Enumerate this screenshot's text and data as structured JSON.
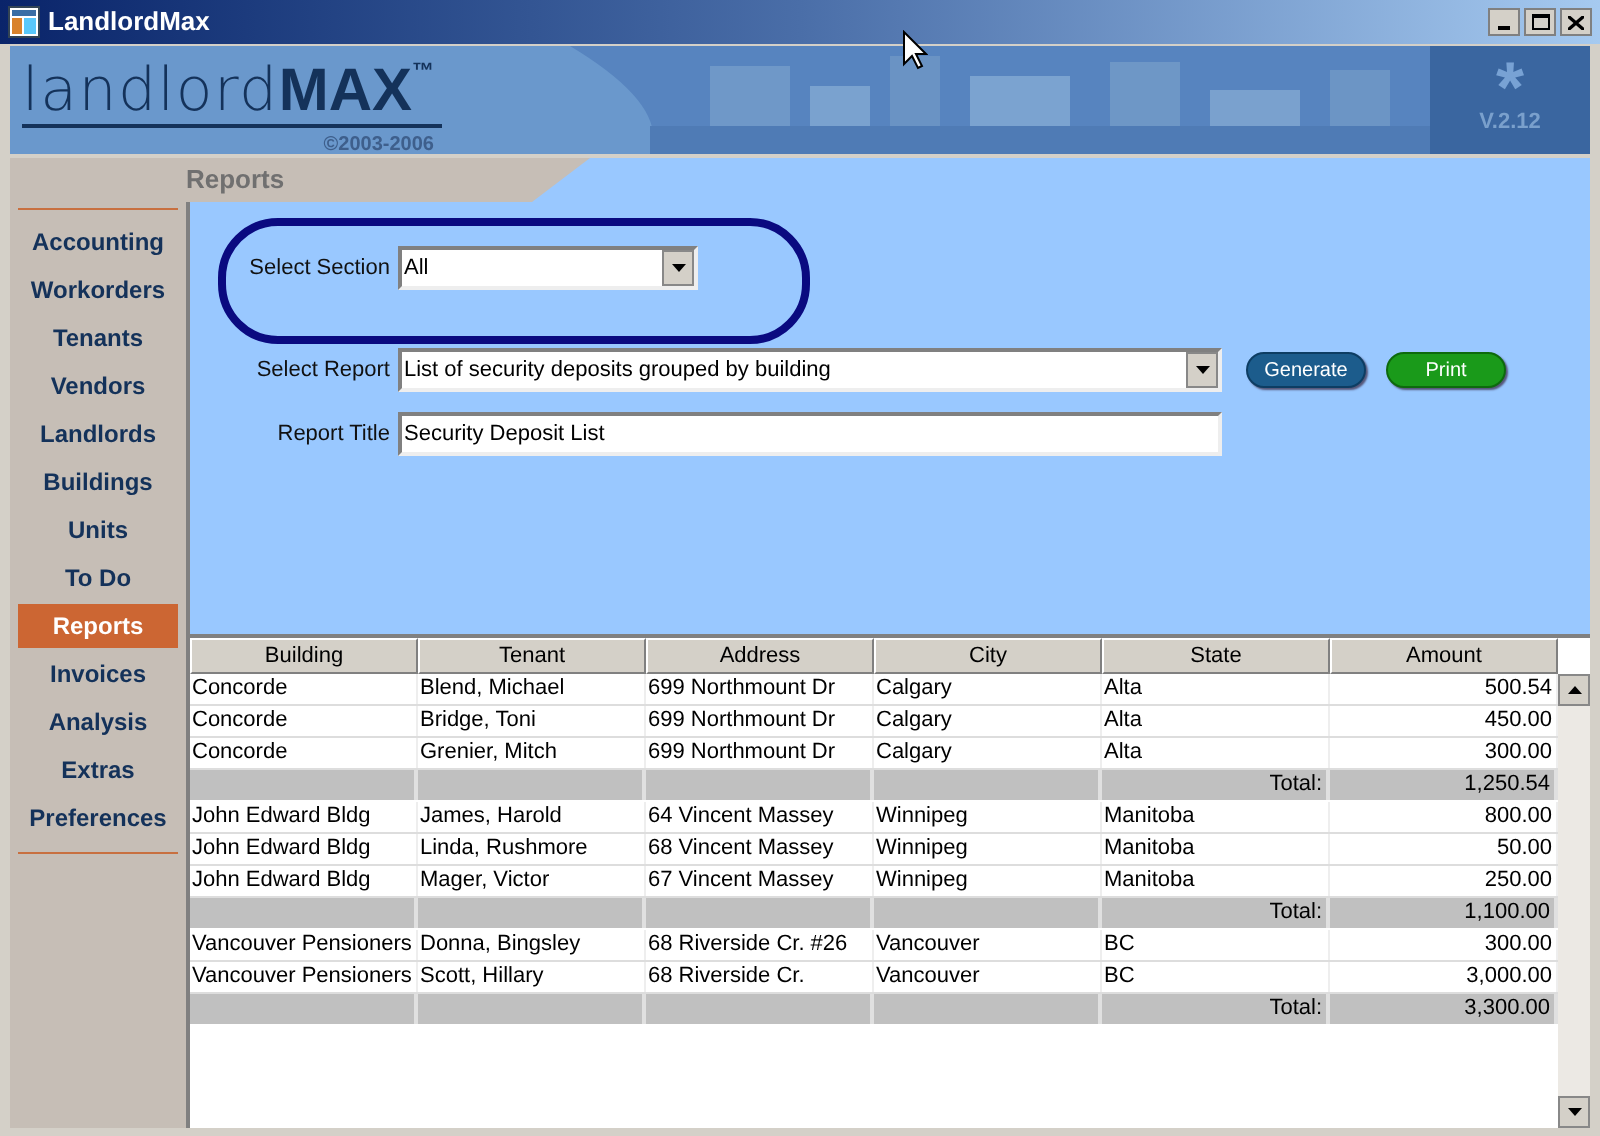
{
  "window": {
    "title": "LandlordMax"
  },
  "banner": {
    "logo_light": "landlord",
    "logo_bold": "MAX",
    "trademark": "™",
    "copyright": "©2003-2006",
    "badge_symbol": "*",
    "version": "V.2.12"
  },
  "section_title": "Reports",
  "sidebar": {
    "items": [
      {
        "label": "Accounting",
        "selected": false
      },
      {
        "label": "Workorders",
        "selected": false
      },
      {
        "label": "Tenants",
        "selected": false
      },
      {
        "label": "Vendors",
        "selected": false
      },
      {
        "label": "Landlords",
        "selected": false
      },
      {
        "label": "Buildings",
        "selected": false
      },
      {
        "label": "Units",
        "selected": false
      },
      {
        "label": "To Do",
        "selected": false
      },
      {
        "label": "Reports",
        "selected": true
      },
      {
        "label": "Invoices",
        "selected": false
      },
      {
        "label": "Analysis",
        "selected": false
      },
      {
        "label": "Extras",
        "selected": false
      },
      {
        "label": "Preferences",
        "selected": false
      }
    ]
  },
  "form": {
    "section": {
      "label": "Select Section",
      "value": "All"
    },
    "report": {
      "label": "Select Report",
      "value": "List of security deposits grouped by building"
    },
    "title": {
      "label": "Report Title",
      "value": "Security Deposit List"
    },
    "buttons": [
      {
        "label": "Generate",
        "kind": "primary"
      },
      {
        "label": "Print",
        "kind": "print"
      }
    ]
  },
  "table": {
    "columns": [
      "Building",
      "Tenant",
      "Address",
      "City",
      "State",
      "Amount"
    ],
    "rows": [
      {
        "kind": "data",
        "cells": [
          "Concorde",
          "Blend, Michael",
          "699 Northmount Dr",
          "Calgary",
          "Alta",
          "500.54"
        ]
      },
      {
        "kind": "data",
        "cells": [
          "Concorde",
          "Bridge, Toni",
          "699 Northmount Dr",
          "Calgary",
          "Alta",
          "450.00"
        ]
      },
      {
        "kind": "data",
        "cells": [
          "Concorde",
          "Grenier, Mitch",
          "699 Northmount Dr",
          "Calgary",
          "Alta",
          "300.00"
        ]
      },
      {
        "kind": "total",
        "label": "Total:",
        "amount": "1,250.54"
      },
      {
        "kind": "data",
        "cells": [
          "John Edward Bldg",
          "James, Harold",
          "64 Vincent Massey",
          "Winnipeg",
          "Manitoba",
          "800.00"
        ]
      },
      {
        "kind": "data",
        "cells": [
          "John Edward Bldg",
          "Linda, Rushmore",
          "68 Vincent Massey",
          "Winnipeg",
          "Manitoba",
          "50.00"
        ]
      },
      {
        "kind": "data",
        "cells": [
          "John Edward Bldg",
          "Mager, Victor",
          "67 Vincent Massey",
          "Winnipeg",
          "Manitoba",
          "250.00"
        ]
      },
      {
        "kind": "total",
        "label": "Total:",
        "amount": "1,100.00"
      },
      {
        "kind": "data",
        "cells": [
          "Vancouver Pensioners",
          "Donna, Bingsley",
          "68 Riverside Cr. #26",
          "Vancouver",
          "BC",
          "300.00"
        ]
      },
      {
        "kind": "data",
        "cells": [
          "Vancouver Pensioners",
          "Scott, Hillary",
          "68 Riverside Cr.",
          "Vancouver",
          "BC",
          "3,000.00"
        ]
      },
      {
        "kind": "total",
        "label": "Total:",
        "amount": "3,300.00"
      }
    ]
  }
}
